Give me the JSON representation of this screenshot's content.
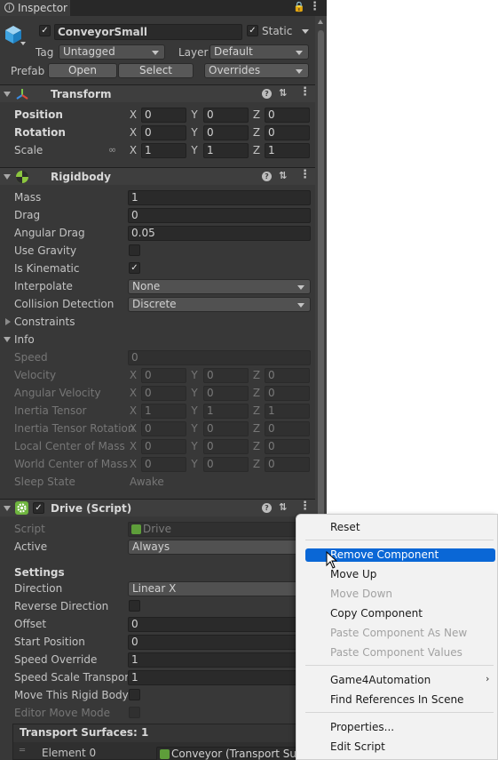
{
  "window": {
    "tab_title": "Inspector"
  },
  "header": {
    "object_name": "ConveyorSmall",
    "static_label": "Static",
    "tag_label": "Tag",
    "tag_value": "Untagged",
    "layer_label": "Layer",
    "layer_value": "Default",
    "prefab_label": "Prefab",
    "open_label": "Open",
    "select_label": "Select",
    "overrides_label": "Overrides"
  },
  "transform": {
    "title": "Transform",
    "position_label": "Position",
    "rotation_label": "Rotation",
    "scale_label": "Scale",
    "position": {
      "x": "0",
      "y": "0",
      "z": "0"
    },
    "rotation": {
      "x": "0",
      "y": "0",
      "z": "0"
    },
    "scale": {
      "x": "1",
      "y": "1",
      "z": "1"
    }
  },
  "axes": {
    "x": "X",
    "y": "Y",
    "z": "Z"
  },
  "rigidbody": {
    "title": "Rigidbody",
    "mass_label": "Mass",
    "mass": "1",
    "drag_label": "Drag",
    "drag": "0",
    "angular_drag_label": "Angular Drag",
    "angular_drag": "0.05",
    "use_gravity_label": "Use Gravity",
    "use_gravity": false,
    "is_kinematic_label": "Is Kinematic",
    "is_kinematic": true,
    "interpolate_label": "Interpolate",
    "interpolate": "None",
    "collision_label": "Collision Detection",
    "collision": "Discrete",
    "constraints_label": "Constraints",
    "info_label": "Info",
    "info": {
      "speed_label": "Speed",
      "speed": "0",
      "velocity_label": "Velocity",
      "velocity": {
        "x": "0",
        "y": "0",
        "z": "0"
      },
      "angular_velocity_label": "Angular Velocity",
      "angular_velocity": {
        "x": "0",
        "y": "0",
        "z": "0"
      },
      "inertia_tensor_label": "Inertia Tensor",
      "inertia_tensor": {
        "x": "1",
        "y": "1",
        "z": "1"
      },
      "inertia_rot_label": "Inertia Tensor Rotation",
      "inertia_rot": {
        "x": "0",
        "y": "0",
        "z": "0"
      },
      "local_com_label": "Local Center of Mass",
      "local_com": {
        "x": "0",
        "y": "0",
        "z": "0"
      },
      "world_com_label": "World Center of Mass",
      "world_com": {
        "x": "0",
        "y": "0",
        "z": "0"
      },
      "sleep_label": "Sleep State",
      "sleep": "Awake"
    }
  },
  "drive": {
    "title": "Drive (Script)",
    "script_label": "Script",
    "script": "Drive",
    "active_label": "Active",
    "active": "Always",
    "settings_label": "Settings",
    "direction_label": "Direction",
    "direction": "Linear X",
    "reverse_label": "Reverse Direction",
    "offset_label": "Offset",
    "offset": "0",
    "start_label": "Start Position",
    "start": "0",
    "speed_override_label": "Speed Override",
    "speed_override": "1",
    "speed_scale_label": "Speed Scale Transport",
    "speed_scale": "1",
    "move_rb_label": "Move This Rigid Body",
    "editor_move_label": "Editor Move Mode",
    "transport_label": "Transport Surfaces: 1",
    "element_label": "Element 0",
    "element_value": "Conveyor (Transport Su"
  },
  "context_menu": {
    "items": [
      "Reset",
      "Remove Component",
      "Move Up",
      "Move Down",
      "Copy Component",
      "Paste Component As New",
      "Paste Component Values",
      "Game4Automation",
      "Find References In Scene",
      "Properties...",
      "Edit Script"
    ]
  },
  "colors": {
    "highlight": "#0a67d6",
    "panel": "#383838",
    "header": "#3e3e3e",
    "menu": "#f2f2f2"
  }
}
